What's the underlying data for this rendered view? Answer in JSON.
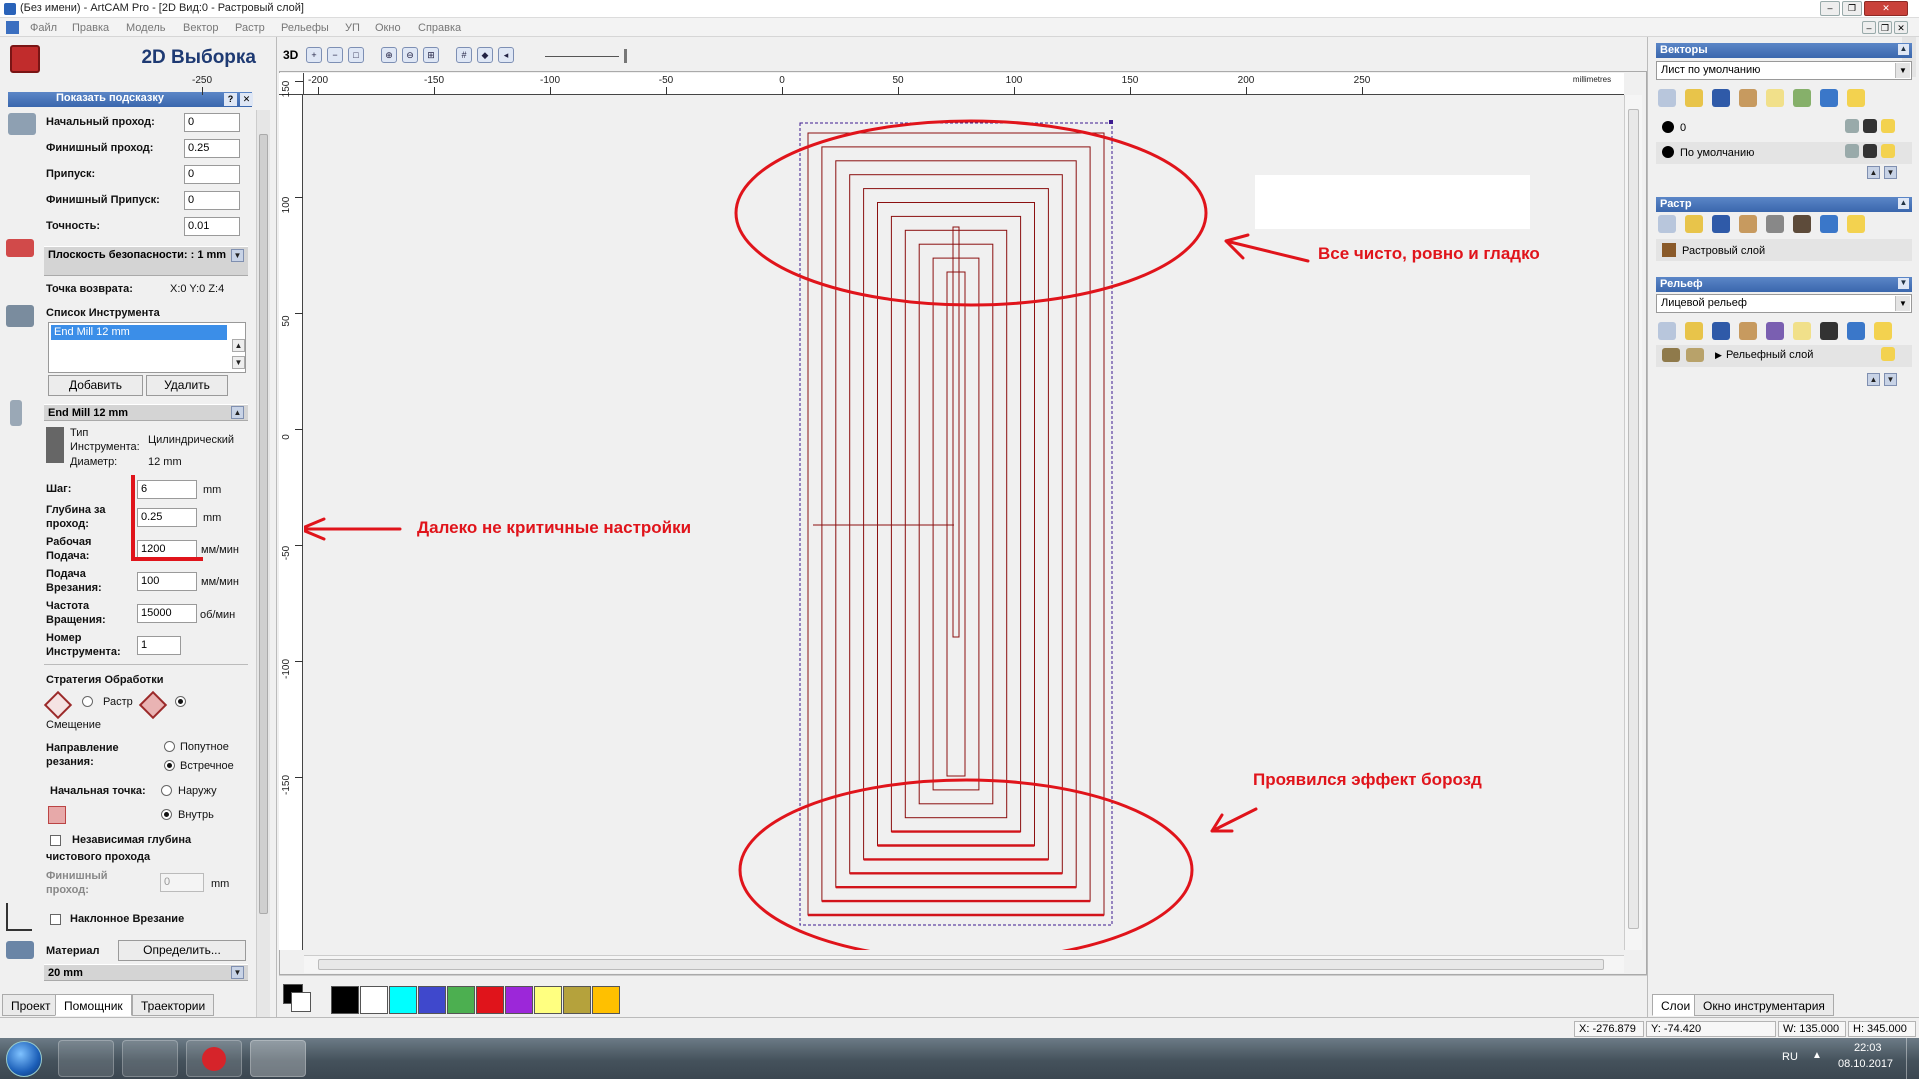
{
  "window": {
    "title": "(Без имени) - ArtCAM Pro - [2D Вид:0 - Растровый слой]"
  },
  "menu": [
    "Файл",
    "Правка",
    "Модель",
    "Вектор",
    "Растр",
    "Рельефы",
    "УП",
    "Окно",
    "Справка"
  ],
  "left_panel": {
    "title": "2D Выборка",
    "hint_bar": "Показать подсказку",
    "hint_help": "?",
    "hint_close": "✕",
    "fields": {
      "start_pass_label": "Начальный проход:",
      "start_pass_value": "0",
      "finish_pass_label": "Финишный проход:",
      "finish_pass_value": "0.25",
      "allowance_label": "Припуск:",
      "allowance_value": "0",
      "finish_allowance_label": "Финишный Припуск:",
      "finish_allowance_value": "0",
      "tolerance_label": "Точность:",
      "tolerance_value": "0.01"
    },
    "safety": {
      "label": "Плоскость безопасности: : 1 mm",
      "return_label": "Точка возврата:",
      "return_value": "X:0 Y:0 Z:4"
    },
    "tool_list": {
      "label": "Список Инструмента",
      "items": [
        "End Mill 12 mm"
      ],
      "add": "Добавить",
      "remove": "Удалить"
    },
    "tool": {
      "header": "End Mill 12 mm",
      "type_label_1": "Тип",
      "type_label_2": "Инструмента:",
      "type_value": "Цилиндрический",
      "diameter_label": "Диаметр:",
      "diameter_value": "12 mm",
      "step_label": "Шаг:",
      "step_value": "6",
      "step_unit": "mm",
      "depth_label_1": "Глубина за",
      "depth_label_2": "проход:",
      "depth_value": "0.25",
      "depth_unit": "mm",
      "feed_label_1": "Рабочая",
      "feed_label_2": "Подача:",
      "feed_value": "1200",
      "feed_unit": "мм/мин",
      "plunge_label_1": "Подача",
      "plunge_label_2": "Врезания:",
      "plunge_value": "100",
      "plunge_unit": "мм/мин",
      "rpm_label_1": "Частота",
      "rpm_label_2": "Вращения:",
      "rpm_value": "15000",
      "rpm_unit": "об/мин",
      "num_label_1": "Номер",
      "num_label_2": "Инструмента:",
      "num_value": "1"
    },
    "strategy": {
      "label": "Стратегия Обработки",
      "raster": "Растр",
      "offset": "Смещение",
      "direction_label_1": "Направление",
      "direction_label_2": "резания:",
      "climb": "Попутное",
      "conventional": "Встречное",
      "start_label": "Начальная точка:",
      "outside": "Наружу",
      "inside": "Внутрь",
      "independent_1": "Независимая глубина",
      "independent_2": "чистового прохода",
      "finish_label_1": "Финишный",
      "finish_label_2": "проход:",
      "finish_value": "0",
      "finish_unit": "mm",
      "ramp": "Наклонное Врезание"
    },
    "material": {
      "label": "Материал",
      "define": "Определить...",
      "thickness": "20 mm"
    },
    "tabs": [
      "Проект",
      "Помощник",
      "Траектории"
    ]
  },
  "view_toolbar": {
    "mode_3d": "3D"
  },
  "rulers": {
    "h_ticks": [
      "-250",
      "-200",
      "-150",
      "-100",
      "-50",
      "0",
      "50",
      "100",
      "150",
      "200",
      "250"
    ],
    "h_unit": "millimetres",
    "v_ticks": [
      "150",
      "100",
      "50",
      "0",
      "-50",
      "-100",
      "-150"
    ]
  },
  "annotations": {
    "top": "Все чисто, ровно и гладко",
    "middle": "Далеко не критичные настройки",
    "bottom": "Проявился эффект борозд"
  },
  "palette": [
    "#000000",
    "#ffffff",
    "#00ffff",
    "#3f48cc",
    "#4caf50",
    "#e0141b",
    "#9c27d9",
    "#ffff80",
    "#b5a23c",
    "#ffc000"
  ],
  "right_panel": {
    "vectors": {
      "title": "Векторы",
      "sheet": "Лист по умолчанию",
      "layers": [
        "0",
        "По умолчанию"
      ]
    },
    "raster": {
      "title": "Растр",
      "layer": "Растровый слой"
    },
    "relief": {
      "title": "Рельеф",
      "combo": "Лицевой рельеф",
      "layer": "Рельефный слой"
    },
    "tabs": [
      "Слои",
      "Окно инструментария"
    ]
  },
  "status": {
    "x": "X: -276.879",
    "y": "Y: -74.420",
    "w": "W: 135.000",
    "h": "H: 345.000"
  },
  "taskbar": {
    "lang": "RU",
    "time": "22:03",
    "date": "08.10.2017"
  }
}
